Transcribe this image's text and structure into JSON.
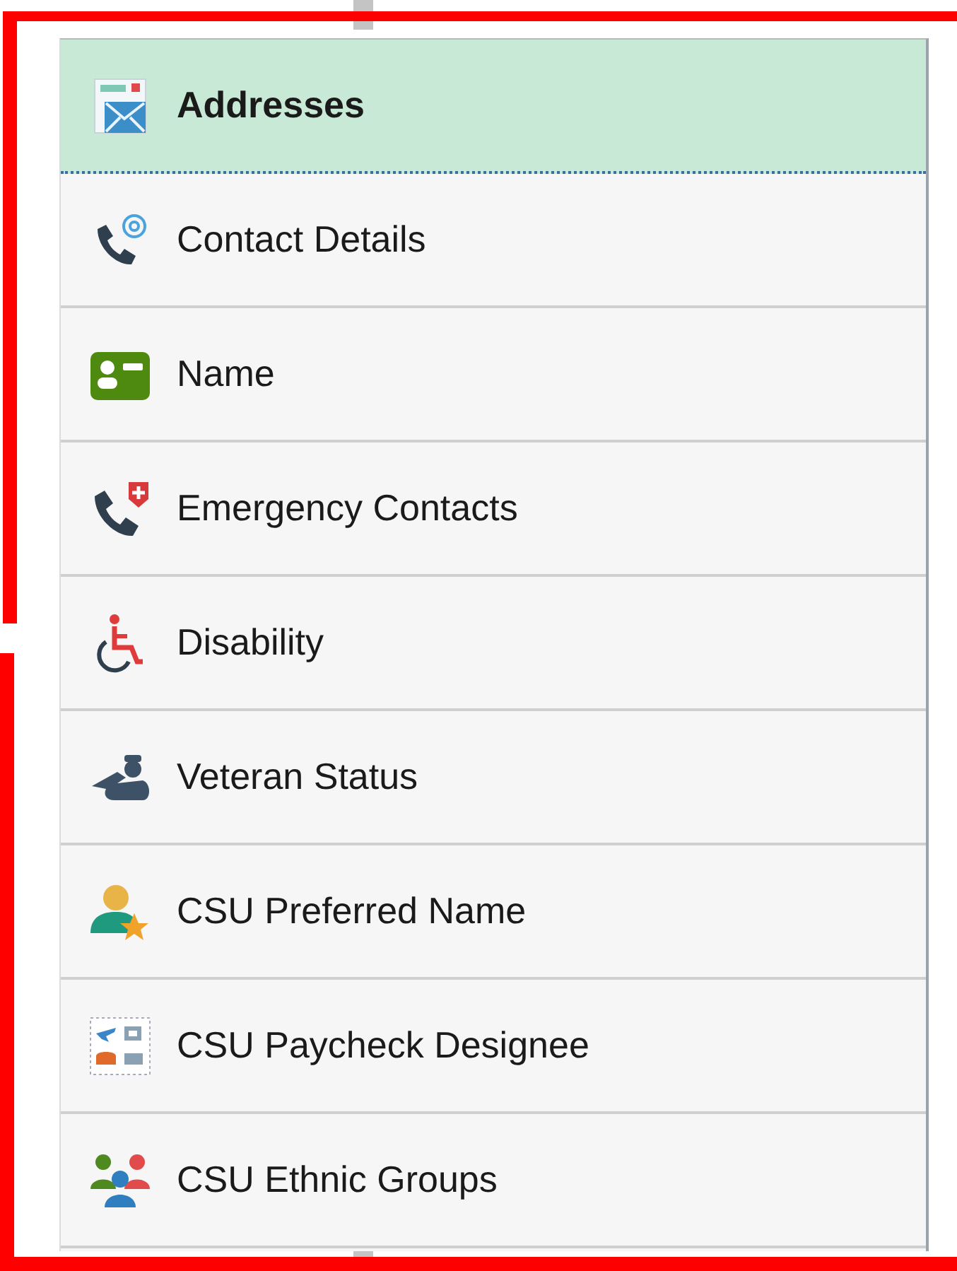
{
  "menu": {
    "items": [
      {
        "label": "Addresses",
        "selected": true
      },
      {
        "label": "Contact Details",
        "selected": false
      },
      {
        "label": "Name",
        "selected": false
      },
      {
        "label": "Emergency Contacts",
        "selected": false
      },
      {
        "label": "Disability",
        "selected": false
      },
      {
        "label": "Veteran Status",
        "selected": false
      },
      {
        "label": "CSU Preferred Name",
        "selected": false
      },
      {
        "label": "CSU Paycheck Designee",
        "selected": false
      },
      {
        "label": "CSU Ethnic Groups",
        "selected": false
      }
    ]
  }
}
